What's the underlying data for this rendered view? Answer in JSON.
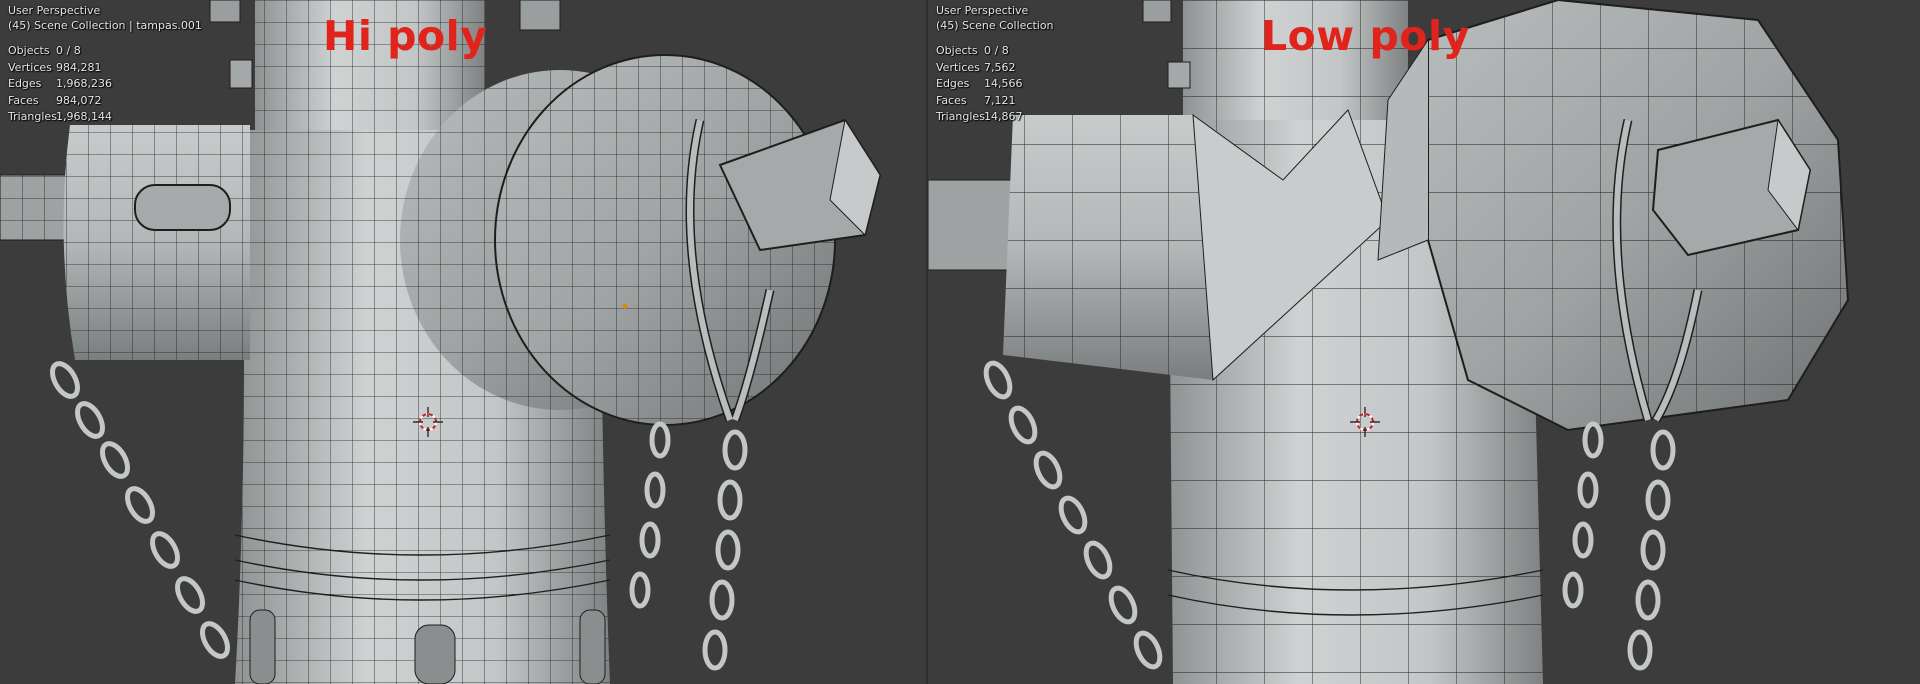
{
  "viewports": [
    {
      "perspective_label": "User Perspective",
      "collection_label": "(45) Scene Collection | tampas.001",
      "overlay_label": "Hi poly",
      "stats": [
        {
          "label": "Objects",
          "value": "0 / 8"
        },
        {
          "label": "Vertices",
          "value": "984,281"
        },
        {
          "label": "Edges",
          "value": "1,968,236"
        },
        {
          "label": "Faces",
          "value": "984,072"
        },
        {
          "label": "Triangles",
          "value": "1,968,144"
        }
      ]
    },
    {
      "perspective_label": "User Perspective",
      "collection_label": "(45) Scene Collection",
      "overlay_label": "Low poly",
      "stats": [
        {
          "label": "Objects",
          "value": "0 / 8"
        },
        {
          "label": "Vertices",
          "value": "7,562"
        },
        {
          "label": "Edges",
          "value": "14,566"
        },
        {
          "label": "Faces",
          "value": "7,121"
        },
        {
          "label": "Triangles",
          "value": "14,867"
        }
      ]
    }
  ],
  "colors": {
    "background": "#3c3c3c",
    "overlay_text": "#e0241b",
    "mesh_light": "#d2d4d4",
    "mesh_mid": "#a9adad",
    "mesh_dark": "#6f7373",
    "wire": "#1c1c1c",
    "origin_dot": "#e08a00"
  },
  "icons": {
    "cursor": "3d-cursor-icon"
  }
}
